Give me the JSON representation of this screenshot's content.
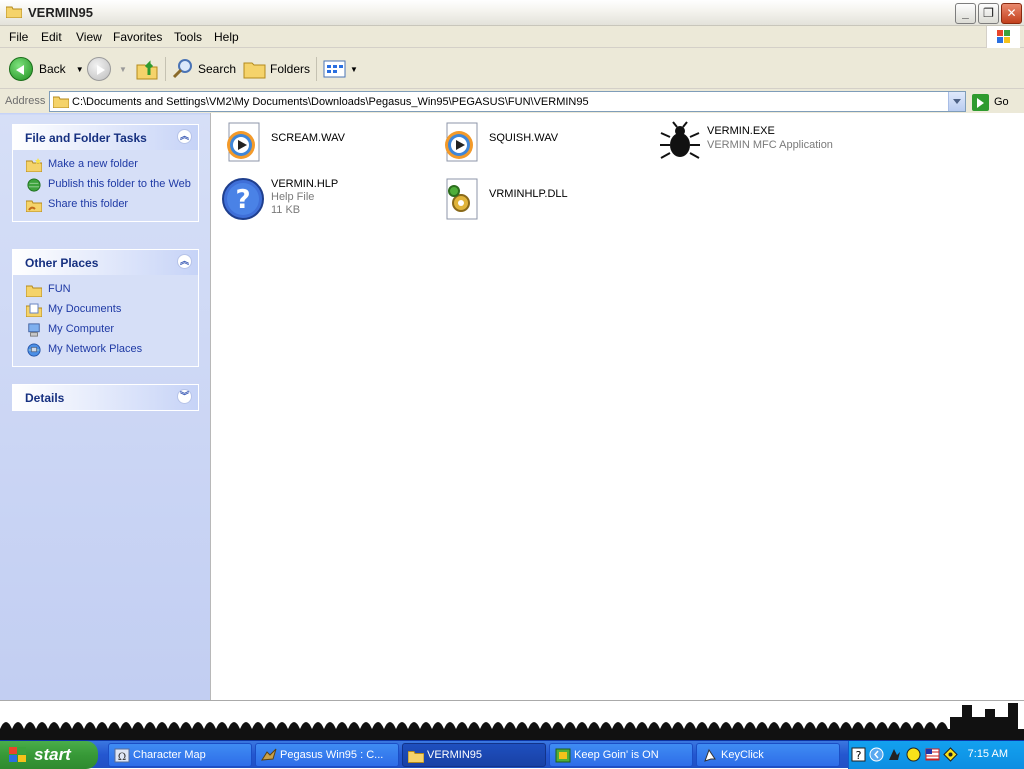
{
  "window": {
    "title": "VERMIN95"
  },
  "menu": [
    "File",
    "Edit",
    "View",
    "Favorites",
    "Tools",
    "Help"
  ],
  "toolbar": {
    "back_label": "Back",
    "search_label": "Search",
    "folders_label": "Folders"
  },
  "address": {
    "label": "Address",
    "value": "C:\\Documents and Settings\\VM2\\My Documents\\Downloads\\Pegasus_Win95\\PEGASUS\\FUN\\VERMIN95",
    "go_label": "Go"
  },
  "taskpane": {
    "file_tasks": {
      "title": "File and Folder Tasks",
      "items": [
        "Make a new folder",
        "Publish this folder to the Web",
        "Share this folder"
      ]
    },
    "other_places": {
      "title": "Other Places",
      "items": [
        "FUN",
        "My Documents",
        "My Computer",
        "My Network Places"
      ]
    },
    "details": {
      "title": "Details"
    }
  },
  "files": [
    {
      "name": "SCREAM.WAV",
      "icon": "media-player-icon"
    },
    {
      "name": "SQUISH.WAV",
      "icon": "media-player-icon"
    },
    {
      "name": "VERMIN.EXE",
      "sub1": "VERMIN MFC Application",
      "icon": "bug-icon"
    },
    {
      "name": "VERMIN.HLP",
      "sub1": "Help File",
      "sub2": "11 KB",
      "icon": "help-icon"
    },
    {
      "name": "VRMINHLP.DLL",
      "icon": "dll-gear-icon"
    }
  ],
  "taskbar": {
    "start_label": "start",
    "tasks": [
      "Character Map",
      "Pegasus Win95 : C...",
      "VERMIN95",
      "Keep Goin' is ON",
      "KeyClick"
    ],
    "clock": "7:15 AM"
  }
}
